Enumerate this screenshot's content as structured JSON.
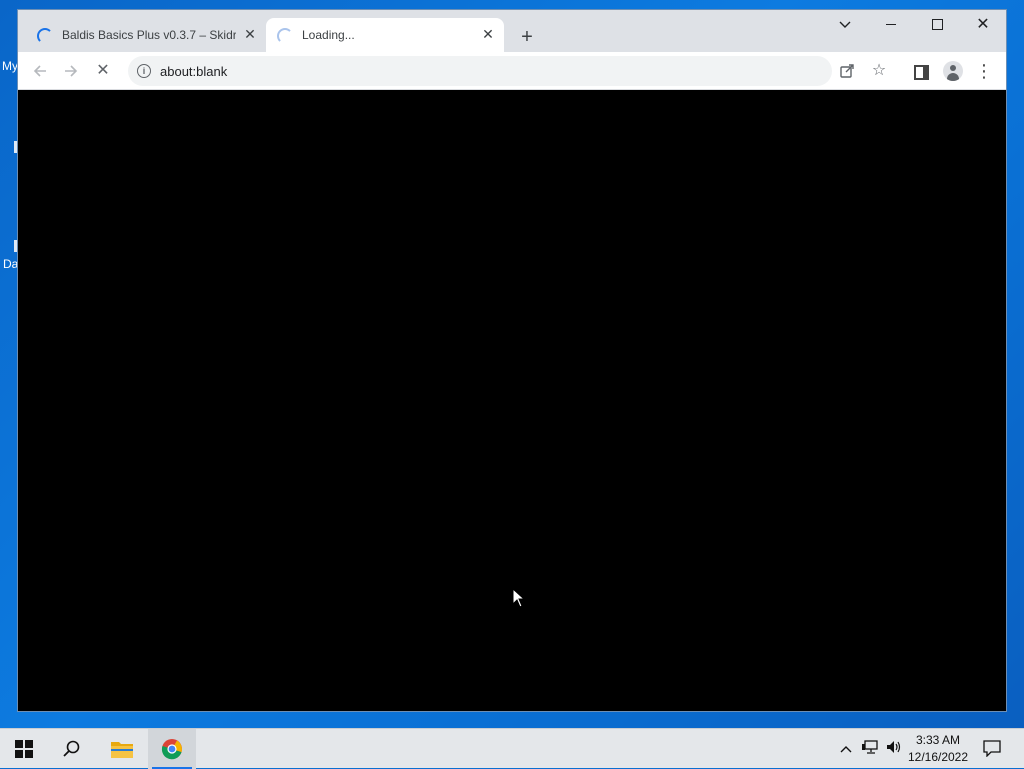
{
  "desktop": {
    "fragments": [
      "My",
      "Da"
    ]
  },
  "browser": {
    "tabs": [
      {
        "title": "Baldis Basics Plus v0.3.7 – Skidrow",
        "state": "loading",
        "close": "✕"
      },
      {
        "title": "Loading...",
        "state": "loading",
        "close": "✕"
      }
    ],
    "new_tab": "+",
    "tab_search_icon": "chevron-down-icon",
    "window_controls": {
      "close": "✕"
    },
    "toolbar": {
      "back_icon": "arrow-left-icon",
      "forward_icon": "arrow-right-icon",
      "stop_icon": "stop-loading-icon",
      "stop": "✕",
      "url": "about:blank",
      "share_icon": "share-icon",
      "bookmark_star": "☆",
      "menu": "⋮"
    },
    "content_background": "#000000",
    "accent": "#1a73e8"
  },
  "taskbar": {
    "apps": [
      "start-icon",
      "search-icon",
      "file-explorer-icon",
      "chrome-icon"
    ],
    "active_app": "chrome-icon",
    "tray": {
      "chevron": "^",
      "clock_time": "3:33 AM",
      "clock_date": "12/16/2022"
    }
  }
}
